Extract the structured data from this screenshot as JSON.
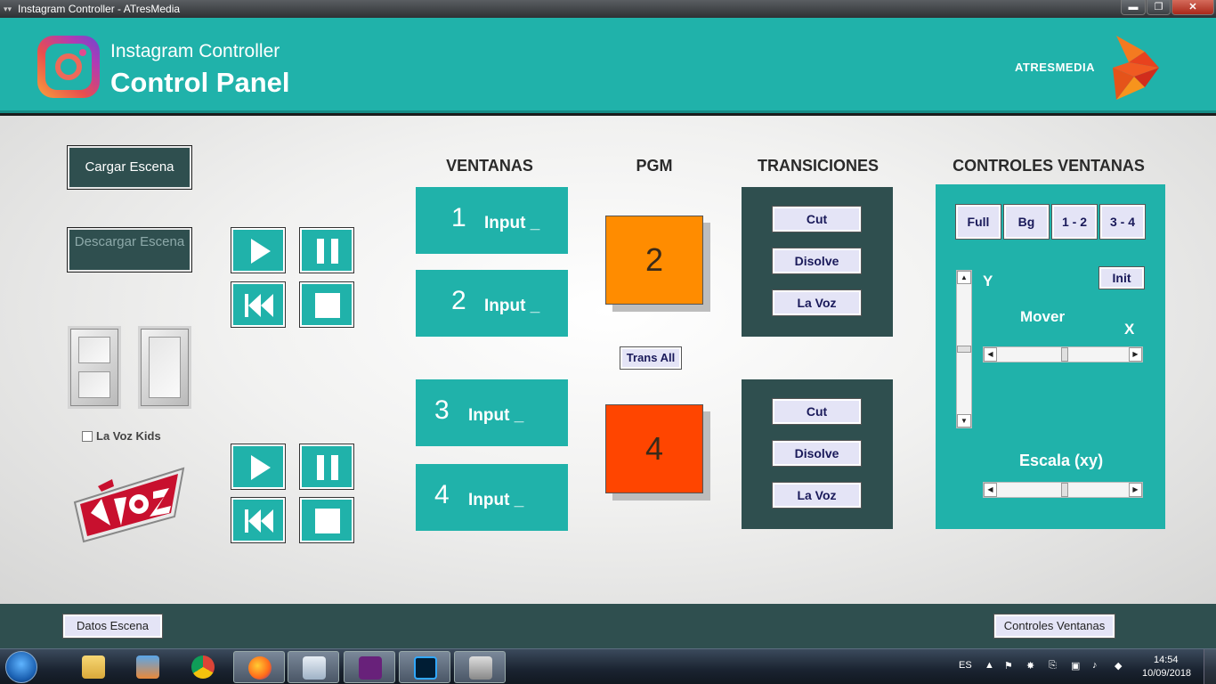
{
  "window": {
    "title": "Instagram Controller - ATresMedia",
    "minimize": "▬",
    "maximize": "❐",
    "close": "✕"
  },
  "header": {
    "subtitle": "Instagram Controller",
    "title": "Control Panel",
    "brand": "ATRESMEDIA"
  },
  "left": {
    "cargar_label": "Cargar Escena",
    "descargar_label": "Descargar Escena",
    "lavoz_kids_label": "La Voz Kids"
  },
  "columns": {
    "ventanas": "VENTANAS",
    "pgm": "PGM",
    "transiciones": "TRANSICIONES",
    "controles": "CONTROLES VENTANAS"
  },
  "windows": [
    {
      "num": "1",
      "label": "Input _"
    },
    {
      "num": "2",
      "label": "Input _"
    },
    {
      "num": "3",
      "label": "Input _"
    },
    {
      "num": "4",
      "label": "Input _"
    }
  ],
  "pgm": {
    "top_value": "2",
    "top_color": "#ff8c00",
    "bottom_value": "4",
    "bottom_color": "#ff4500",
    "trans_all_label": "Trans All"
  },
  "transitions": {
    "cut": "Cut",
    "disolve": "Disolve",
    "lavoz": "La Voz"
  },
  "controls": {
    "full": "Full",
    "bg": "Bg",
    "one_two": "1 - 2",
    "three_four": "3 - 4",
    "init": "Init",
    "y_label": "Y",
    "x_label": "X",
    "mover_label": "Mover",
    "escala_label": "Escala (xy)"
  },
  "footer": {
    "datos_label": "Datos Escena",
    "controles_label": "Controles Ventanas"
  },
  "taskbar": {
    "lang": "ES",
    "time": "14:54",
    "date": "10/09/2018"
  },
  "colors": {
    "teal": "#20b2aa",
    "dark_slate": "#2f4f4f"
  }
}
